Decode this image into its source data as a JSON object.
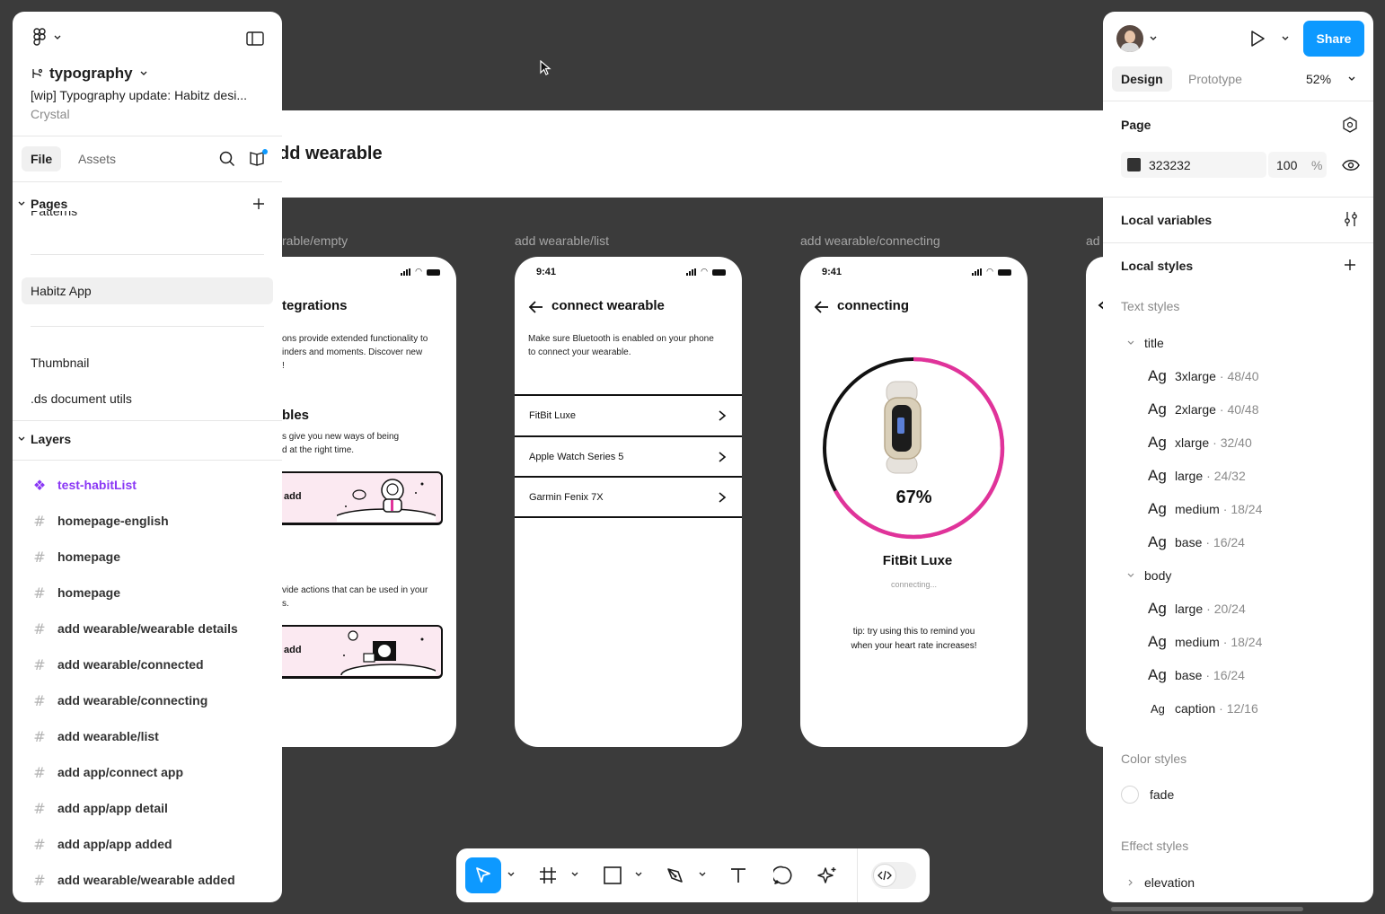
{
  "canvas": {
    "banner_title": "dd wearable",
    "frames": [
      {
        "label": "rable/empty"
      },
      {
        "label": "add wearable/list"
      },
      {
        "label": "add wearable/connecting"
      },
      {
        "label": "ad"
      }
    ],
    "empty_screen": {
      "heading1": "tegrations",
      "para1_line1": "ons provide extended functionality to",
      "para1_line2": "inders and moments. Discover new",
      "para1_line3": "!",
      "heading2": "bles",
      "para2_line1": "s give you new ways of being",
      "para2_line2": "d at the right time.",
      "card1_label": "add",
      "para3_line1": "vide actions that can be used in your",
      "para3_line2": "s.",
      "card2_label": "add"
    },
    "list_screen": {
      "time": "9:41",
      "title": "connect wearable",
      "desc_line1": "Make sure Bluetooth is enabled on your phone",
      "desc_line2": "to connect your wearable.",
      "devices": [
        "FitBit Luxe",
        "Apple Watch Series 5",
        "Garmin Fenix 7X"
      ]
    },
    "connecting_screen": {
      "time": "9:41",
      "title": "connecting",
      "progress_label": "67%",
      "progress": 0.67,
      "device": "FitBit Luxe",
      "status": "connecting...",
      "tip_line1": "tip: try using this to remind you",
      "tip_line2": "when your heart rate increases!",
      "ring_color": "#e0339a"
    }
  },
  "left_panel": {
    "file_name": "typography",
    "file_desc": "[wip] Typography update: Habitz desi...",
    "owner": "Crystal",
    "tabs": {
      "file": "File",
      "assets": "Assets"
    },
    "pages_header": "Pages",
    "pages_partial": "Patterns",
    "pages": [
      "Habitz App",
      "Thumbnail",
      ".ds document utils"
    ],
    "layers_header": "Layers",
    "layers": [
      "test-habitList",
      "homepage-english",
      "homepage",
      "homepage",
      "add wearable/wearable details",
      "add wearable/connected",
      "add wearable/connecting",
      "add wearable/list",
      "add app/connect app",
      "add app/app detail",
      "add app/app added",
      "add wearable/wearable added"
    ]
  },
  "right_panel": {
    "share_label": "Share",
    "tabs": {
      "design": "Design",
      "prototype": "Prototype"
    },
    "zoom": "52%",
    "page_header": "Page",
    "page_color_hex": "323232",
    "page_color_swatch": "#323232",
    "page_opacity": "100",
    "page_opacity_unit": "%",
    "local_variables": "Local variables",
    "local_styles": "Local styles",
    "text_styles_label": "Text styles",
    "title_group": "title",
    "title_styles": [
      {
        "ag": "Ag",
        "name": "3xlarge",
        "meta": "· 48/40"
      },
      {
        "ag": "Ag",
        "name": "2xlarge",
        "meta": "· 40/48"
      },
      {
        "ag": "Ag",
        "name": "xlarge",
        "meta": "· 32/40"
      },
      {
        "ag": "Ag",
        "name": "large",
        "meta": "· 24/32"
      },
      {
        "ag": "Ag",
        "name": "medium",
        "meta": "· 18/24"
      },
      {
        "ag": "Ag",
        "name": "base",
        "meta": "· 16/24"
      }
    ],
    "body_group": "body",
    "body_styles": [
      {
        "ag": "Ag",
        "name": "large",
        "meta": "· 20/24"
      },
      {
        "ag": "Ag",
        "name": "medium",
        "meta": "· 18/24"
      },
      {
        "ag": "Ag",
        "name": "base",
        "meta": "· 16/24"
      },
      {
        "ag": "Ag",
        "name": "caption",
        "meta": "· 12/16"
      }
    ],
    "color_styles_label": "Color styles",
    "color_style": "fade",
    "effect_styles_label": "Effect styles",
    "effect_style": "elevation"
  },
  "colors": {
    "accent": "#0d99ff",
    "component": "#8a38f5"
  }
}
